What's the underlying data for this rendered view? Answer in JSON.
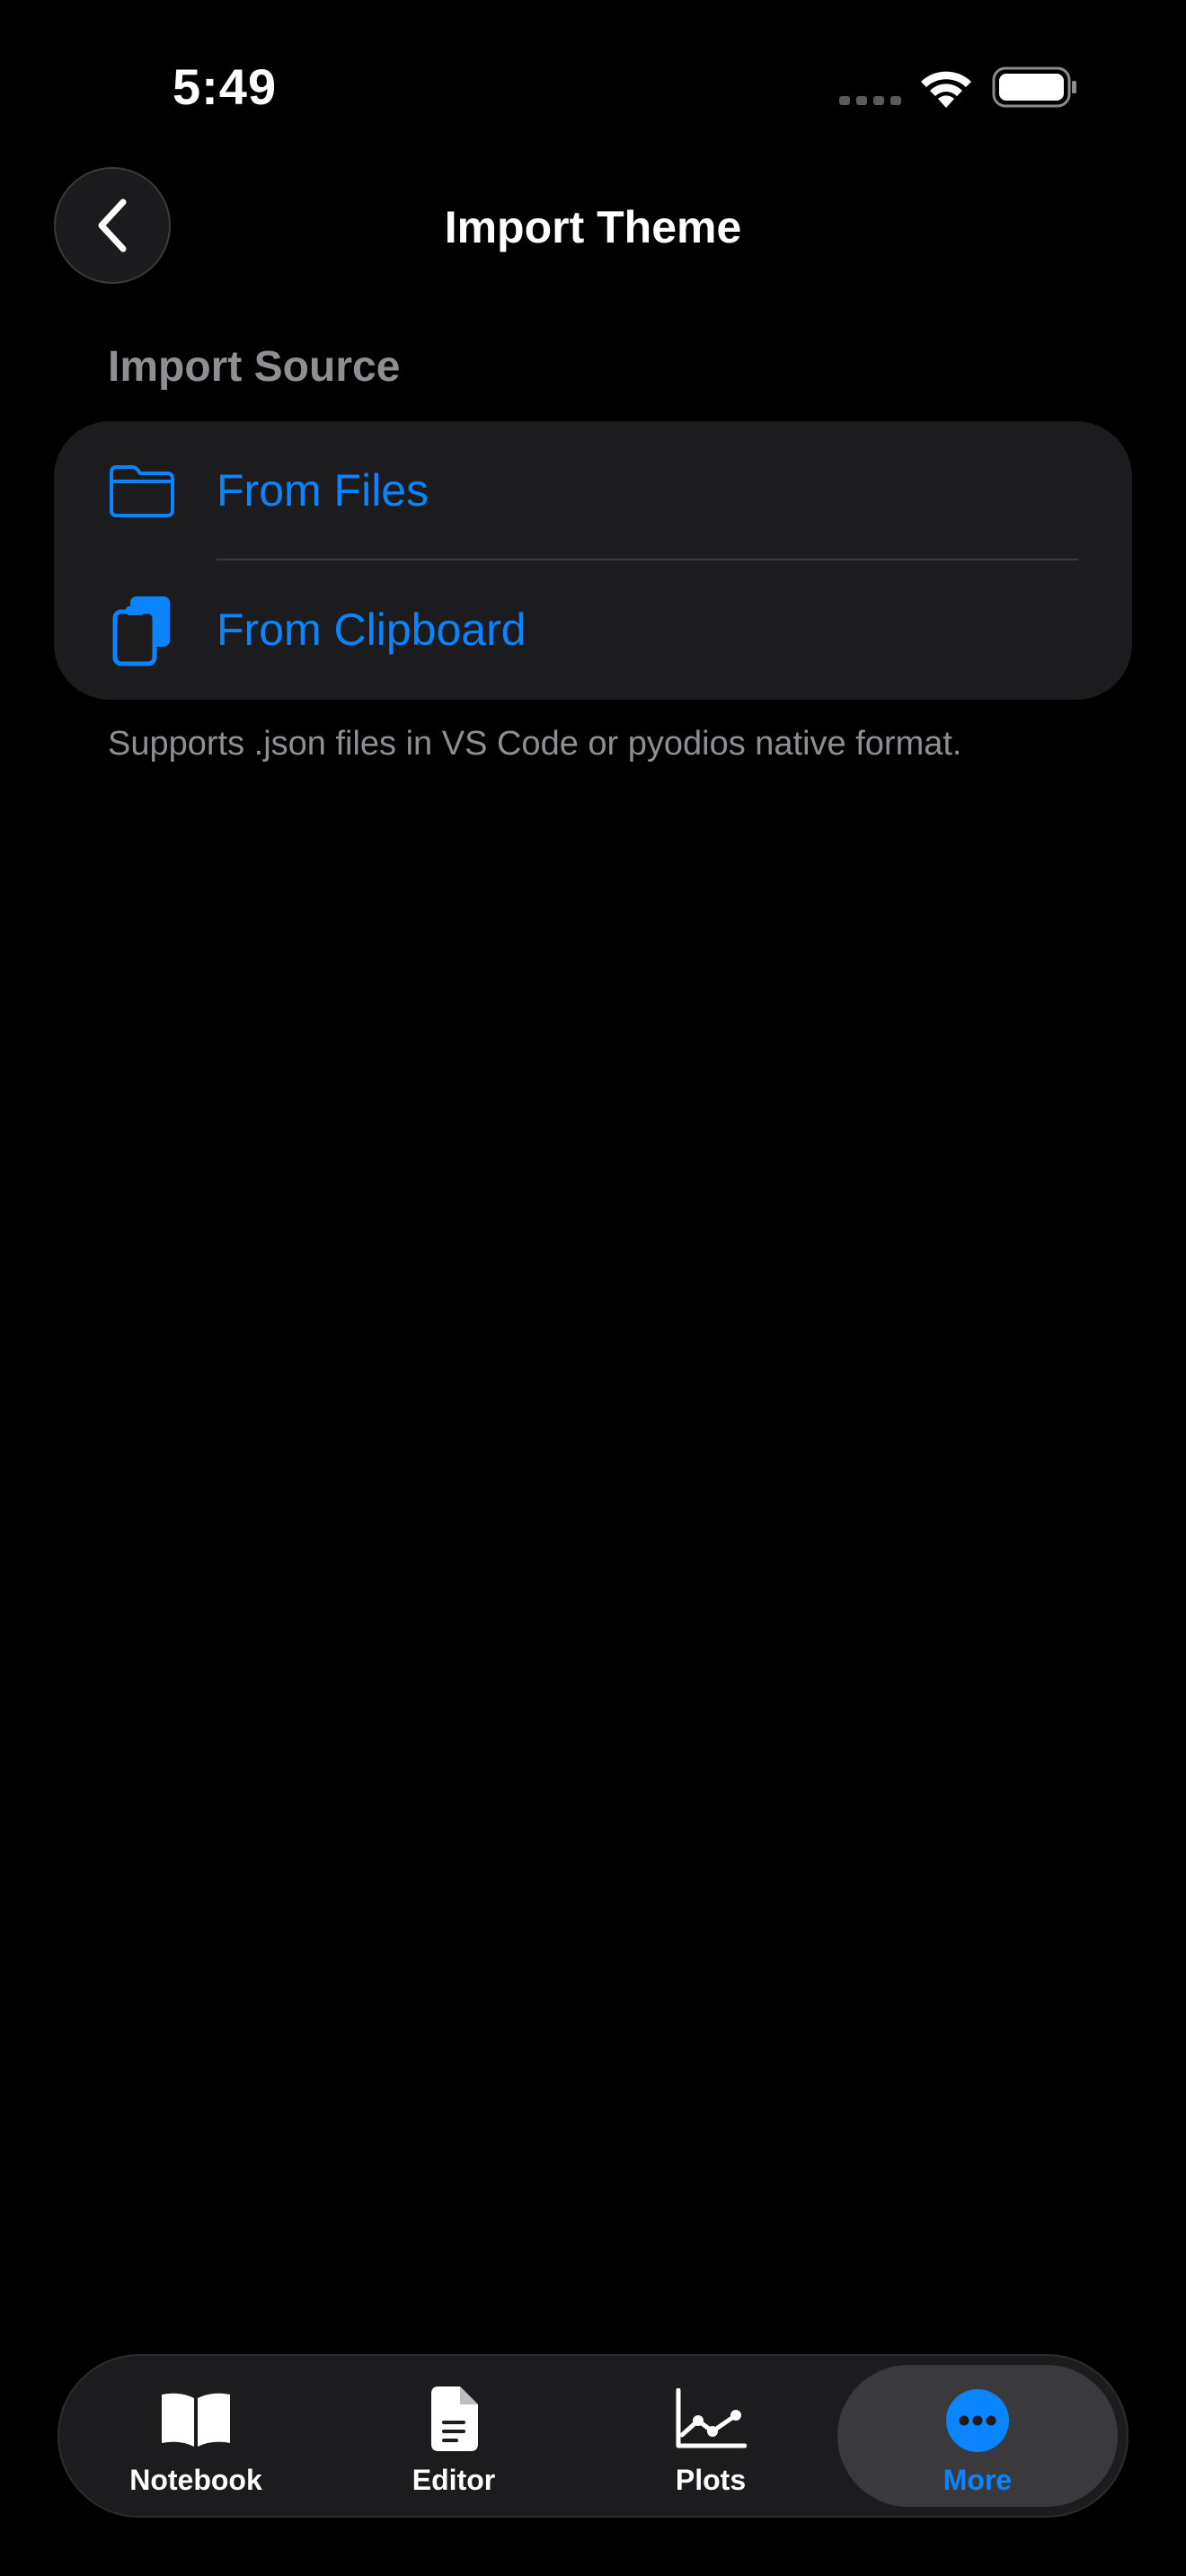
{
  "status_bar": {
    "time": "5:49"
  },
  "header": {
    "title": "Import Theme",
    "back_icon": "chevron-left-icon"
  },
  "import_source": {
    "section_title": "Import Source",
    "options": [
      {
        "label": "From Files",
        "icon": "folder-icon"
      },
      {
        "label": "From Clipboard",
        "icon": "clipboard-icon"
      }
    ],
    "footer_note": "Supports .json files in VS Code or pyodios native format."
  },
  "tab_bar": {
    "tabs": [
      {
        "label": "Notebook",
        "icon": "book-icon",
        "selected": false
      },
      {
        "label": "Editor",
        "icon": "document-icon",
        "selected": false
      },
      {
        "label": "Plots",
        "icon": "chart-line-icon",
        "selected": false
      },
      {
        "label": "More",
        "icon": "ellipsis-circle-icon",
        "selected": true
      }
    ]
  },
  "colors": {
    "background": "#000000",
    "card": "#1c1c1e",
    "accent": "#0a84ff",
    "secondary_text": "#8e8e93",
    "separator": "#3a3a3c"
  }
}
